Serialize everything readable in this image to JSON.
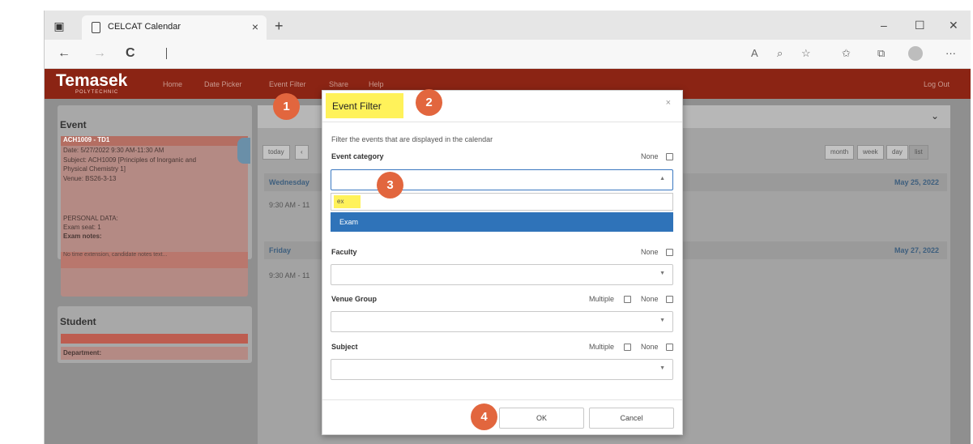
{
  "browser": {
    "tab_title": "CELCAT Calendar",
    "tab_close": "×",
    "new_tab": "+",
    "minimize": "–",
    "maximize": "☐",
    "close": "✕",
    "back": "←",
    "forward": "→",
    "reload": "C",
    "more": "···"
  },
  "app": {
    "logo": "Temasek",
    "logo_sub": "POLYTECHNIC",
    "nav": [
      "Home",
      "Date Picker",
      "Event Filter",
      "Share",
      "Help"
    ],
    "logout": "Log Out"
  },
  "sidebar": {
    "event_heading": "Event",
    "event_code": "ACH1009 - TD1",
    "date": "Date: 5/27/2022 9:30 AM-11:30 AM",
    "subject_line1": "Subject: ACH1009 [Principles of Inorganic and",
    "subject_line2": "Physical Chemistry 1]",
    "venue": "Venue: BS26-3-13",
    "personal_data": "PERSONAL DATA:",
    "exam_seat": "Exam seat: 1",
    "exam_notes": "Exam notes:",
    "notes_text": "No time extension, candidate notes text...",
    "student_heading": "Student",
    "department": "Department:"
  },
  "calendar": {
    "today": "today",
    "views": [
      "month",
      "week",
      "day",
      "list"
    ],
    "rows": [
      {
        "day": "Wednesday",
        "date": "May 25, 2022",
        "time": "9:30 AM - 11"
      },
      {
        "day": "Friday",
        "date": "May 27, 2022",
        "time": "9:30 AM - 11"
      }
    ]
  },
  "modal": {
    "title": "Event Filter",
    "close": "×",
    "description": "Filter the events that are displayed in the calendar",
    "fields": [
      {
        "label": "Event category",
        "options": [
          "None"
        ]
      },
      {
        "label": "Faculty",
        "options": [
          "None"
        ]
      },
      {
        "label": "Venue Group",
        "options": [
          "Multiple",
          "None"
        ]
      },
      {
        "label": "Subject",
        "options": [
          "Multiple",
          "None"
        ]
      }
    ],
    "search_value": "ex",
    "dropdown_option": "Exam",
    "ok_label": "OK",
    "cancel_label": "Cancel"
  },
  "callouts": [
    "1",
    "2",
    "3",
    "4"
  ],
  "colors": {
    "brand": "#8b2414",
    "highlight": "#fff25a",
    "callout": "#e2663e",
    "selected_option": "#2f73b9"
  }
}
